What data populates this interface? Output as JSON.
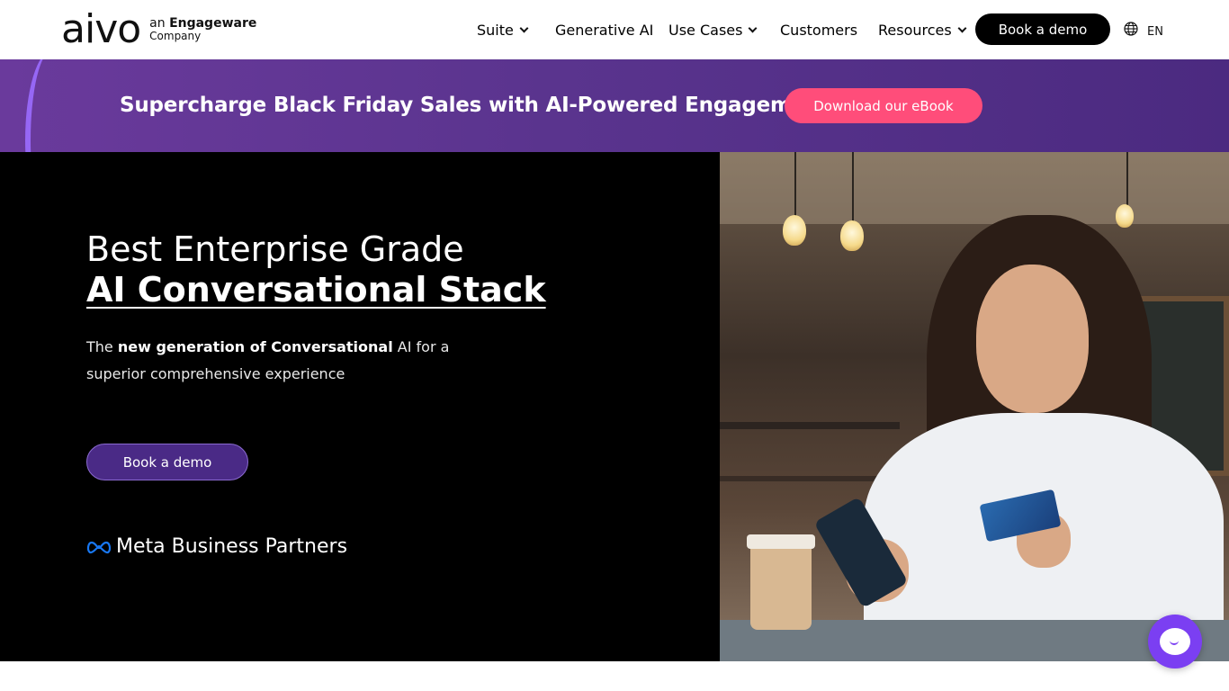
{
  "header": {
    "logo_word": "aivo",
    "logo_sub_prefix": "an ",
    "logo_sub_brand": "Engageware",
    "logo_sub_line2": "Company",
    "nav": [
      {
        "label": "Suite",
        "has_dropdown": true
      },
      {
        "label": "Generative AI",
        "has_dropdown": false
      },
      {
        "label": "Use Cases",
        "has_dropdown": true
      },
      {
        "label": "Customers",
        "has_dropdown": false
      },
      {
        "label": "Resources",
        "has_dropdown": true
      }
    ],
    "cta_label": "Book a demo",
    "language": "EN",
    "globe_icon": "globe-icon"
  },
  "banner": {
    "title": "Supercharge Black Friday Sales with AI-Powered Engagement",
    "cta_label": "Download our eBook"
  },
  "hero": {
    "title_line1": "Best Enterprise Grade",
    "title_line2": "AI Conversational Stack",
    "subtitle_pre": "The ",
    "subtitle_bold": "new generation of Conversational",
    "subtitle_post": " AI for a superior comprehensive experience",
    "cta_label": "Book a demo",
    "partner_label": "Meta Business Partners",
    "partner_icon": "meta-logo-icon"
  },
  "chat": {
    "icon": "chat-bubble-icon"
  },
  "colors": {
    "banner_bg": "#5a348e",
    "ebook_button": "#ff4d7a",
    "hero_button": "#4a2a86",
    "chat_button": "#7b3ff2",
    "nav_cta_bg": "#000000"
  }
}
